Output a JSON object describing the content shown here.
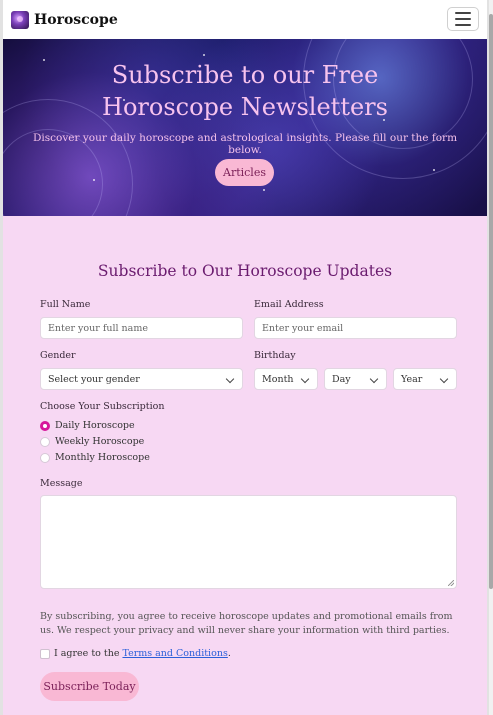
{
  "navbar": {
    "brand": "Horoscope",
    "brand_icon": "zodiac-logo-icon",
    "toggler_icon": "hamburger-menu-icon"
  },
  "hero": {
    "title": "Subscribe to our Free Horoscope Newsletters",
    "subtitle": "Discover your daily horoscope and astrological insights. Please fill our the form below.",
    "button": "Articles"
  },
  "form": {
    "title": "Subscribe to Our Horoscope Updates",
    "full_name": {
      "label": "Full Name",
      "placeholder": "Enter your full name"
    },
    "email": {
      "label": "Email Address",
      "placeholder": "Enter your email"
    },
    "gender": {
      "label": "Gender",
      "value": "Select your gender"
    },
    "birthday": {
      "label": "Birthday",
      "month": "Month",
      "day": "Day",
      "year": "Year"
    },
    "subscription": {
      "label": "Choose Your Subscription",
      "options": [
        {
          "label": "Daily Horoscope",
          "checked": true
        },
        {
          "label": "Weekly Horoscope",
          "checked": false
        },
        {
          "label": "Monthly Horoscope",
          "checked": false
        }
      ]
    },
    "message": {
      "label": "Message"
    },
    "disclaimer": "By subscribing, you agree to receive horoscope updates and promotional emails from us. We respect your privacy and will never share your information with third parties.",
    "agree": {
      "prefix": "I agree to the ",
      "link": "Terms and Conditions",
      "suffix": "."
    },
    "submit": "Subscribe Today"
  },
  "colors": {
    "page_bg": "#f7d8f3",
    "accent": "#d6169b",
    "button_bg": "#f9b8d4",
    "title_color": "#6a1b6e",
    "hero_text": "#f7c3ee"
  }
}
